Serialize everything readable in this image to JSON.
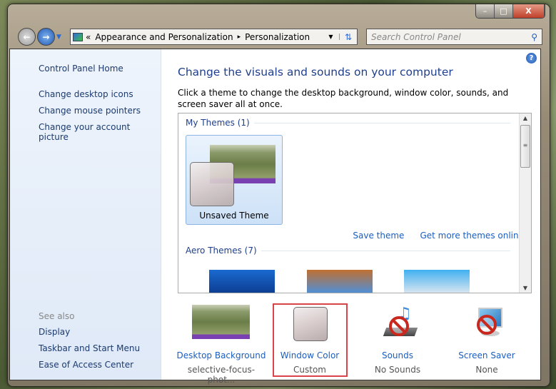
{
  "window": {
    "controls": {
      "minimize": "–",
      "maximize": "□",
      "close": "X"
    }
  },
  "address": {
    "overflow": "«",
    "crumbs": [
      "Appearance and Personalization",
      "Personalization"
    ],
    "separator": "▸"
  },
  "search": {
    "placeholder": "Search Control Panel"
  },
  "sidebar": {
    "home": "Control Panel Home",
    "links": [
      "Change desktop icons",
      "Change mouse pointers",
      "Change your account picture"
    ],
    "see_also": "See also",
    "see_links": [
      "Display",
      "Taskbar and Start Menu",
      "Ease of Access Center"
    ]
  },
  "main": {
    "title": "Change the visuals and sounds on your computer",
    "description": "Click a theme to change the desktop background, window color, sounds, and screen saver all at once.",
    "help": "?",
    "my_themes": "My Themes (1)",
    "unsaved_theme": "Unsaved Theme",
    "save_theme": "Save theme",
    "get_more": "Get more themes online",
    "aero_themes": "Aero Themes (7)"
  },
  "bottom": [
    {
      "label": "Desktop Background",
      "value": "selective-focus-phot..."
    },
    {
      "label": "Window Color",
      "value": "Custom",
      "selected": true
    },
    {
      "label": "Sounds",
      "value": "No Sounds"
    },
    {
      "label": "Screen Saver",
      "value": "None"
    }
  ],
  "colors": {
    "link": "#1a5ebf",
    "heading": "#1e3f8c",
    "selection_outline": "#d9434a"
  }
}
